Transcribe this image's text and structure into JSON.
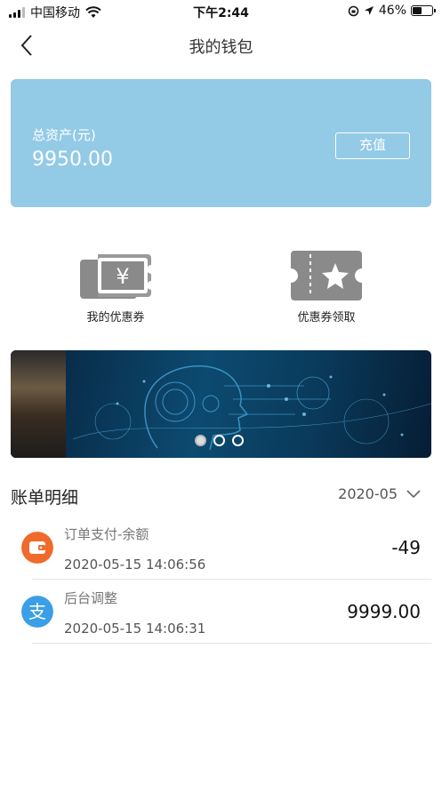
{
  "status_bar": {
    "carrier": "中国移动",
    "time": "下午2:44",
    "battery": "46%",
    "battery_level": 0.46
  },
  "nav": {
    "title": "我的钱包"
  },
  "wallet": {
    "asset_label": "总资产(元)",
    "asset_value": "9950.00",
    "recharge_label": "充值",
    "card_color": "#93cae6"
  },
  "entries": {
    "my_coupons": "我的优惠券",
    "get_coupons": "优惠券领取"
  },
  "banner": {
    "slides": 3,
    "active_index": 0
  },
  "bills": {
    "title": "账单明细",
    "month": "2020-05",
    "records": [
      {
        "title": "订单支付-余额",
        "time": "2020-05-15 14:06:56",
        "amount": "-49",
        "icon": "wallet-icon",
        "icon_color": "#f06a2b"
      },
      {
        "title": "后台调整",
        "time": "2020-05-15 14:06:31",
        "amount": "9999.00",
        "icon": "alipay-icon",
        "icon_color": "#3a9fe6"
      }
    ]
  }
}
